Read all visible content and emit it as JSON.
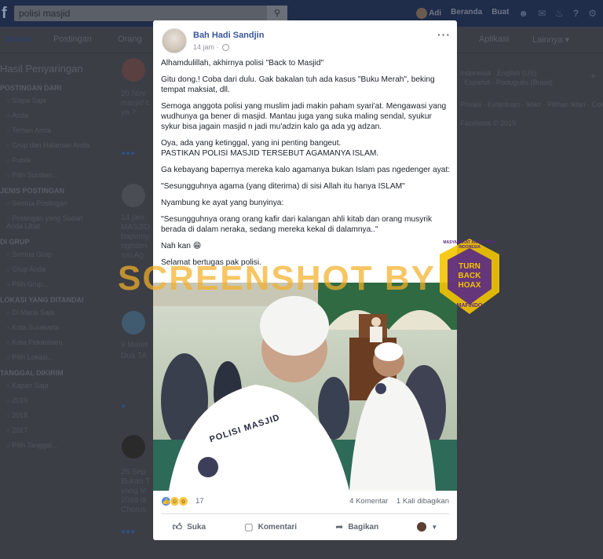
{
  "topbar": {
    "search_value": "polisi masjid",
    "user_name": "Adi",
    "nav_home": "Beranda",
    "nav_find": "Buat"
  },
  "tabs": [
    "Semua",
    "Postingan",
    "Orang",
    "Aplikasi",
    "Lainnya ▾"
  ],
  "sidebar": {
    "heading": "Hasil Penyaringan",
    "sections": [
      {
        "title": "POSTINGAN DARI",
        "items": [
          "Siapa Saja",
          "Anda",
          "Teman Anda",
          "Grup dan Halaman Anda",
          "Publik",
          "Pilih Sumber..."
        ]
      },
      {
        "title": "JENIS POSTINGAN",
        "items": [
          "Semua Postingan",
          "Postingan yang Sudah Anda Lihat"
        ]
      },
      {
        "title": "DI GRUP",
        "items": [
          "Semua Grup",
          "Grup Anda",
          "Pilih Grup..."
        ]
      },
      {
        "title": "LOKASI YANG DITANDAI",
        "items": [
          "Di Mana Saja",
          "Kota Surakarta",
          "Kota Pekanbaru",
          "Pilih Lokasi..."
        ]
      },
      {
        "title": "TANGGAL DIKIRIM",
        "items": [
          "Kapan Saja",
          "2019",
          "2018",
          "2017",
          "Pilih Tanggal..."
        ]
      }
    ]
  },
  "background_posts": [
    {
      "date": "20 Nov",
      "lines": [
        "masjid c",
        "ya ?"
      ]
    },
    {
      "date": "14 jam",
      "lines": [
        "MASJID",
        "baperny",
        "ngeden",
        "sisi Ag"
      ]
    },
    {
      "date": "9 Maret",
      "lines": [
        "Dua TA"
      ]
    },
    {
      "date": "25 Sep",
      "lines": [
        "Bukan T",
        "yang te",
        "2019 di",
        "Chorus"
      ]
    }
  ],
  "right_column": {
    "languages": [
      "Indonesia · English (US)",
      "· Español · Português (Brasil)"
    ],
    "links": [
      "Privasi · Ketentuan · Iklan · Pilihan Iklan · Cookie",
      "Facebook © 2019"
    ]
  },
  "post": {
    "author": "Bah Hadi Sandjin",
    "time": "14 jam ·",
    "paragraphs": [
      "Alhamdulillah, akhirnya polisi \"Back to Masjid\"",
      "Gitu dong.! Coba dari dulu. Gak bakalan tuh ada kasus \"Buku Merah\", beking tempat maksiat, dll.",
      "Semoga anggota polisi yang muslim jadi makin paham syari'at. Mengawasi yang wudhunya ga bener di masjid. Mantau juga yang suka maling sendal, syukur sykur bisa jagain masjid n jadi mu'adzin kalo ga ada yg adzan.",
      "Oya, ada yang ketinggal, yang ini penting bangeut.\nPASTIKAN POLISI MASJID TERSEBUT AGAMANYA ISLAM.",
      "Ga kebayang bapernya mereka kalo agamanya bukan Islam pas ngedenger ayat:",
      "\"Sesungguhnya agama (yang diterima) di sisi Allah itu hanya ISLAM\"",
      "Nyambung ke ayat yang bunyinya:",
      "\"Sesungguhnya orang orang kafir dari kalangan ahli kitab dan orang musyrik berada di dalam neraka, sedang mereka kekal di dalamnya..\"",
      "Nah kan 😁",
      "Selamat bertugas pak polisi."
    ],
    "photo_text": "POLISI MASJID",
    "reactions_count": "17",
    "comments": "4 Komentar",
    "shares": "1 Kali dibagikan",
    "actions": {
      "like": "Suka",
      "comment": "Komentari",
      "share": "Bagikan"
    }
  },
  "watermark": {
    "text": "SCREENSHOT BY",
    "badge_top": "TURN",
    "badge_mid": "BACK",
    "badge_bottom": "HOAX",
    "badge_ring": "MASYARAKAT ANTI FITNAH INDONESIA",
    "badge_brand": "MAFINDO"
  },
  "colors": {
    "link_blue": "#385898",
    "watermark_orange": "#f4b028",
    "badge_yellow": "#f4c400",
    "badge_purple": "#5b2a86"
  }
}
